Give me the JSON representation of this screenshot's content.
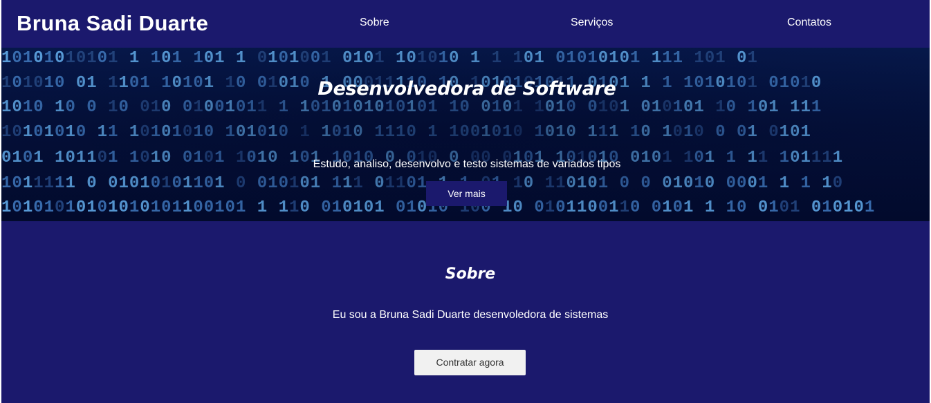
{
  "header": {
    "brand": "Bruna Sadi Duarte",
    "nav": [
      {
        "label": "Sobre"
      },
      {
        "label": "Serviços"
      },
      {
        "label": "Contatos"
      }
    ]
  },
  "hero": {
    "title": "Desenvolvedora de Software",
    "subtitle": "Estudo, analiso, desenvolvo e testo sistemas de variados tipos",
    "button_label": "Ver mais",
    "background_rows": [
      "10101010101 1 101 101 1 0101001 0101 101010 1 1 101 01010101 111 101 01",
      "101010 01 1101 10101 10 01010 1 00011110 10 1010101011 0101 1 1 1010101 01010",
      "1010 10 0 10 010 01001011 1 1010101010101 10 0101 1010 0101 010101 10 101 111",
      "10101010 11 10101010 101010 1 1010 1110 1 1001010 1010 111 10 1010 0 01 0101",
      "0101 101101 1010 0101 1010 101 1010 0 010 0 00 0101 101010 0101 101 1 11 101111",
      "1011111 0 01010101101 0 010101 111 01101 1 1 01 10 110101 0 0 01010 0001 1 1 10",
      "10101010101010101100101 1 110 010101 01010 100 10 0101100110 0101 1 10 0101 010101"
    ]
  },
  "about": {
    "title": "Sobre",
    "text": "Eu sou a Bruna Sadi Duarte desenvoledora de sistemas",
    "button_label": "Contratar agora"
  },
  "colors": {
    "primary": "#1b196d",
    "hero_dark": "#020a2c",
    "binary_bright": "#5a9fdc",
    "binary_dim": "#23457f",
    "button_light": "#f1f1f1"
  }
}
